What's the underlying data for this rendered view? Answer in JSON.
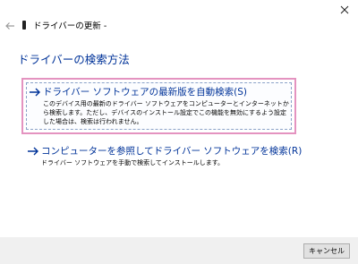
{
  "titlebar": {
    "close_label": "✕"
  },
  "nav": {
    "back_icon": "back-arrow-icon",
    "device_icon": "device-icon",
    "title": "ドライバーの更新 -"
  },
  "main": {
    "section_title": "ドライバーの検索方法",
    "options": [
      {
        "title": "ドライバー ソフトウェアの最新版を自動検索(S)",
        "description": "このデバイス用の最新のドライバー ソフトウェアをコンピューターとインターネットから検索します。ただし、デバイスのインストール設定でこの機能を無効にするよう設定した場合は、検索は行われません。",
        "highlighted": true
      },
      {
        "title": "コンピューターを参照してドライバー ソフトウェアを検索(R)",
        "description": "ドライバー ソフトウェアを手動で検索してインストールします。",
        "highlighted": false
      }
    ]
  },
  "footer": {
    "cancel_label": "キャンセル"
  },
  "colors": {
    "link_blue": "#003399",
    "highlight_pink": "#e493c0",
    "footer_bg": "#f0f0f0"
  }
}
